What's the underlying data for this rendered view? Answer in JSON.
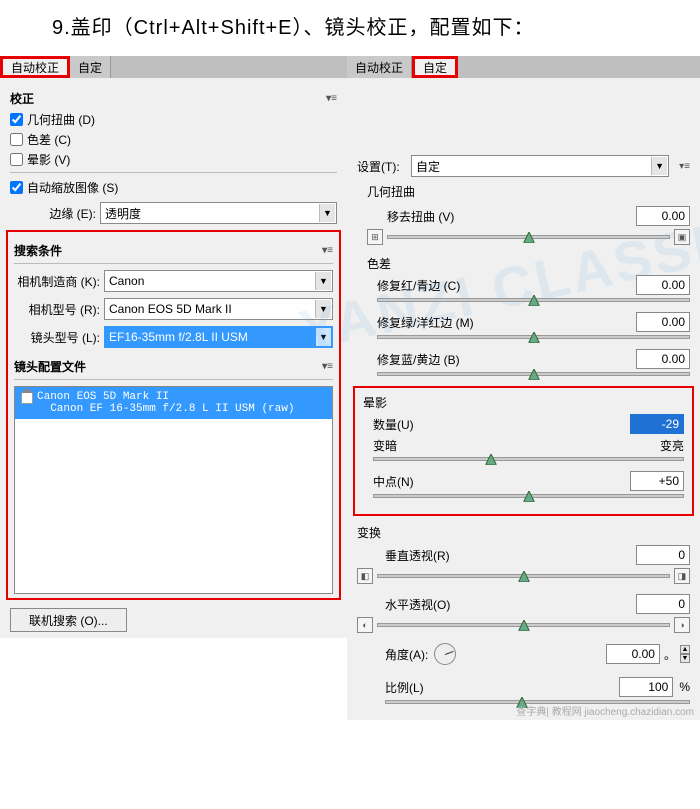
{
  "instruction": "9.盖印（Ctrl+Alt+Shift+E）、镜头校正，配置如下：",
  "left": {
    "tabs": {
      "auto": "自动校正",
      "custom": "自定"
    },
    "correction_title": "校正",
    "geo_distort": "几何扭曲 (D)",
    "chroma": "色差 (C)",
    "vignette": "晕影 (V)",
    "auto_scale": "自动缩放图像 (S)",
    "edge_label": "边缘 (E):",
    "edge_value": "透明度",
    "search_title": "搜索条件",
    "maker_label": "相机制造商 (K):",
    "maker_value": "Canon",
    "model_label": "相机型号 (R):",
    "model_value": "Canon EOS 5D Mark II",
    "lens_label": "镜头型号 (L):",
    "lens_value": "EF16-35mm f/2.8L II USM",
    "profile_title": "镜头配置文件",
    "profile_line1": "Canon EOS 5D Mark II",
    "profile_line2": "Canon EF 16-35mm f/2.8 L II USM (raw)",
    "online_btn": "联机搜索 (O)..."
  },
  "right": {
    "tabs": {
      "auto": "自动校正",
      "custom": "自定"
    },
    "settings_label": "设置(T):",
    "settings_value": "自定",
    "geo_title": "几何扭曲",
    "remove_distort": "移去扭曲 (V)",
    "remove_distort_val": "0.00",
    "chroma_title": "色差",
    "fix_rc": "修复红/青边 (C)",
    "fix_rc_val": "0.00",
    "fix_gm": "修复绿/洋红边 (M)",
    "fix_gm_val": "0.00",
    "fix_by": "修复蓝/黄边 (B)",
    "fix_by_val": "0.00",
    "vig_title": "晕影",
    "amount_label": "数量(U)",
    "amount_val": "-29",
    "darker": "变暗",
    "lighter": "变亮",
    "mid_label": "中点(N)",
    "mid_val": "+50",
    "trans_title": "变换",
    "vpersp": "垂直透视(R)",
    "vpersp_val": "0",
    "hpersp": "水平透视(O)",
    "hpersp_val": "0",
    "angle": "角度(A):",
    "angle_val": "0.00",
    "scale": "比例(L)",
    "scale_val": "100",
    "scale_unit": "%",
    "watermark": "YANZI CLASSROOM",
    "degree": "。"
  },
  "footer": "查字典| 教程网  jiaocheng.chazidian.com"
}
